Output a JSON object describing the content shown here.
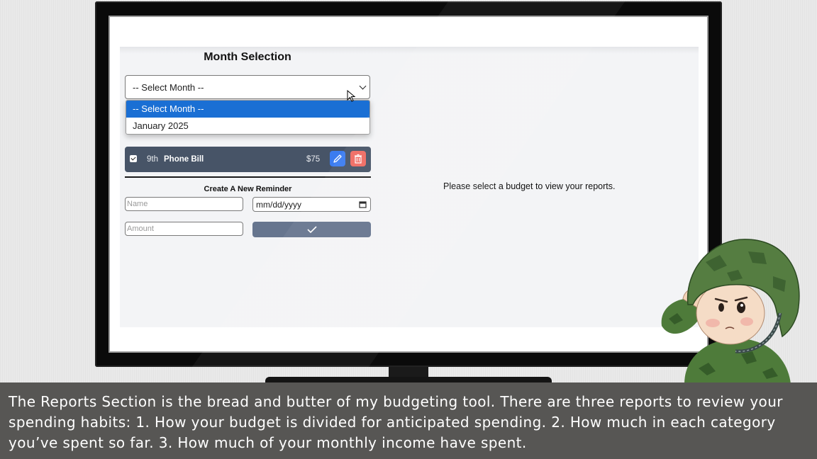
{
  "month_section": {
    "title": "Month Selection",
    "select_value": "-- Select Month --",
    "options": [
      "-- Select Month --",
      "January 2025"
    ]
  },
  "reminders": [
    {
      "day": "9th",
      "name": "Phone Bill",
      "amount": "$75",
      "checked": true
    }
  ],
  "create_reminder": {
    "title": "Create A New Reminder",
    "name_placeholder": "Name",
    "date_placeholder": "mm/dd/yyyy",
    "amount_placeholder": "Amount"
  },
  "reports": {
    "message": "Please select a budget to view your reports."
  },
  "caption": {
    "text": "The Reports Section is the bread and butter of my budgeting tool. There are three reports to review your spending habits: 1. How your budget is divided for anticipated spending. 2. How much in each category you’ve spent so far. 3. How much of your monthly income have spent."
  },
  "colors": {
    "row_bg": "#475467",
    "edit_button": "#3b7cf0",
    "delete_button": "#ef6b62",
    "selected_option": "#1a6fd4",
    "submit_button": "#66758e",
    "caption_bg": "#575654"
  }
}
